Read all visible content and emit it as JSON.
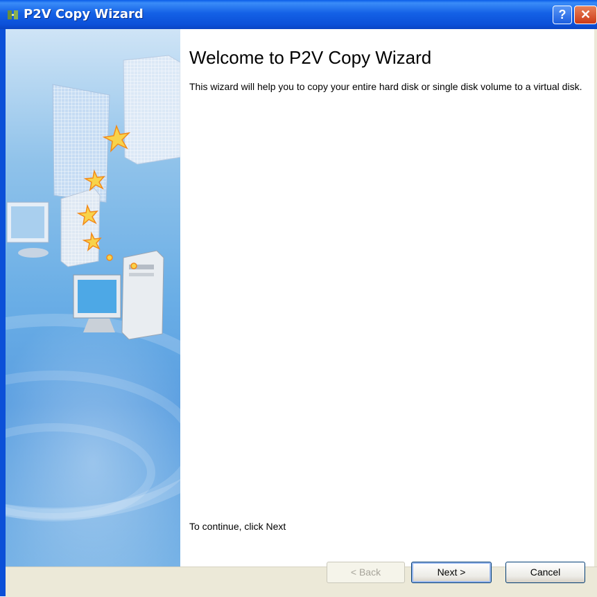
{
  "window": {
    "title": "P2V Copy Wizard",
    "icon": "app-icon",
    "titlebar_buttons": [
      {
        "label": "?",
        "icon": "help-icon"
      },
      {
        "label": "✕",
        "icon": "close-icon"
      }
    ]
  },
  "content": {
    "heading": "Welcome to P2V Copy Wizard",
    "description": "This wizard will help you to copy your entire hard disk or single disk volume to a virtual disk.",
    "continue_text": "To continue, click Next"
  },
  "buttons": {
    "back": "< Back",
    "next": "Next >",
    "cancel": "Cancel"
  },
  "colors": {
    "titlebar": "#0b50d8",
    "panel": "#6aaee6",
    "dialog_bg": "#ece9d8"
  }
}
